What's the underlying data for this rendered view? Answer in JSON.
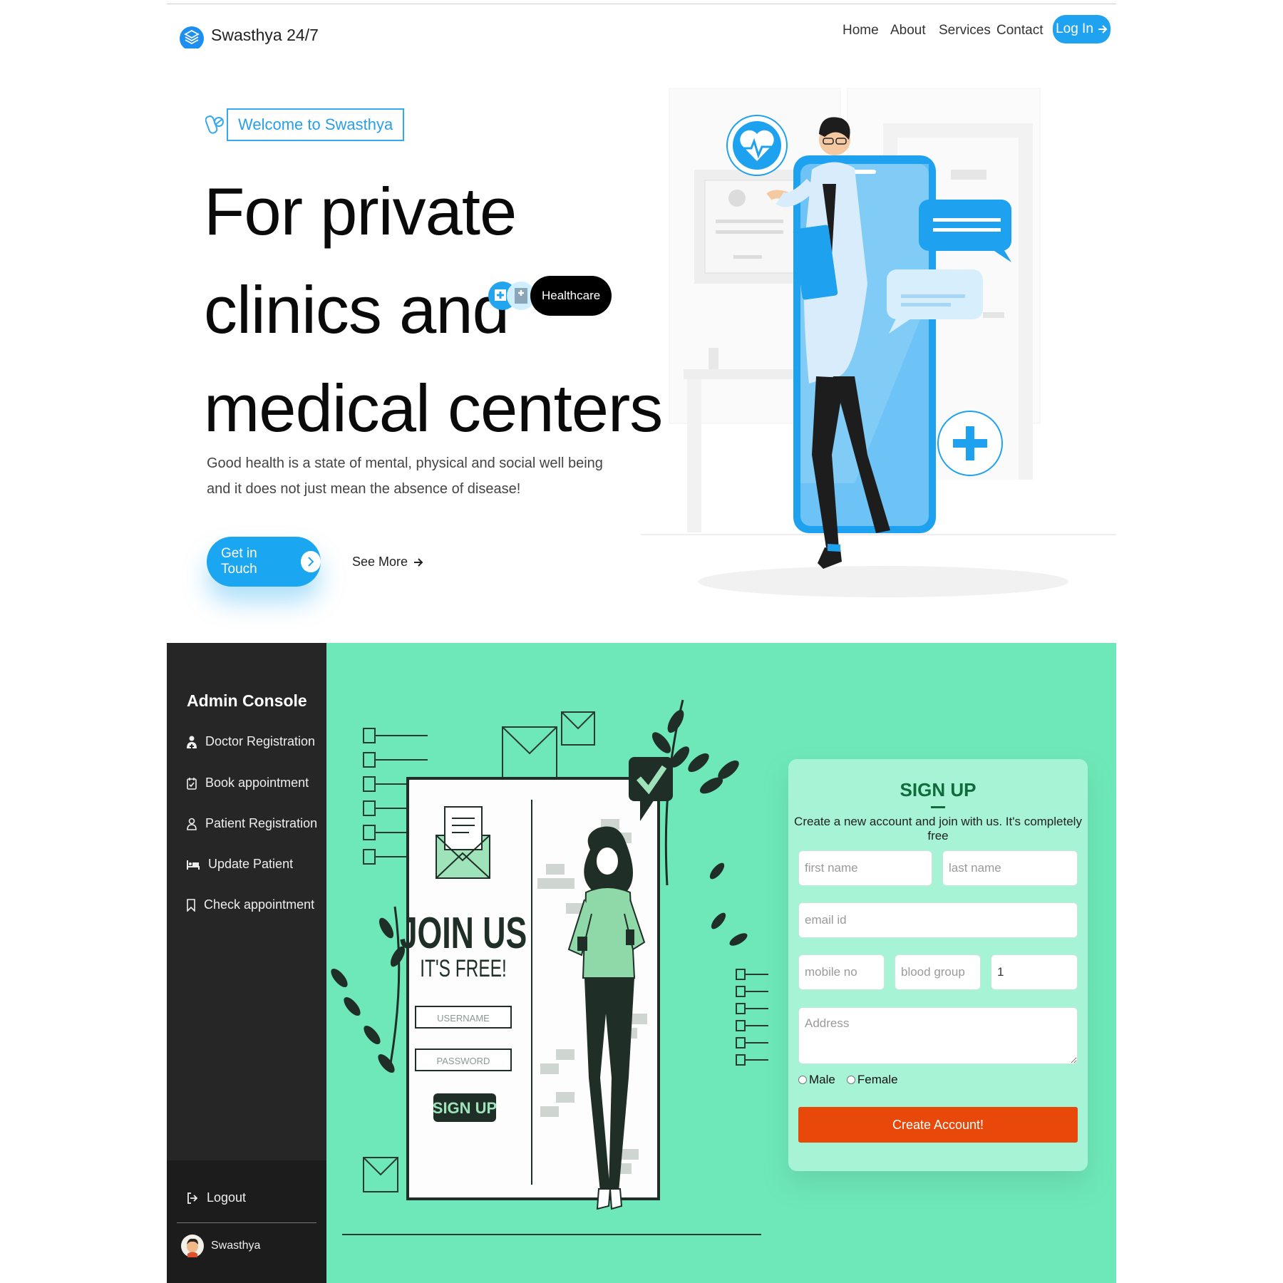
{
  "nav": {
    "brand": "Swasthya 24/7",
    "links": [
      "Home",
      "About",
      "Services",
      "Contact"
    ],
    "login_label": "Log In"
  },
  "hero": {
    "badge": "Welcome to Swasthya",
    "title_lines": [
      "For private",
      "clinics and",
      "medical centers"
    ],
    "tag": "Healthcare",
    "description": "Good health is a state of mental, physical and social well being and it does not just mean the absence of disease!",
    "cta_primary": "Get in Touch",
    "cta_secondary": "See More"
  },
  "sidebar": {
    "title": "Admin Console",
    "items": [
      {
        "label": "Doctor Registration",
        "icon": "doctor-icon"
      },
      {
        "label": "Book appointment",
        "icon": "calendar-check-icon"
      },
      {
        "label": "Patient Registration",
        "icon": "person-icon"
      },
      {
        "label": "Update Patient",
        "icon": "bed-icon"
      },
      {
        "label": "Check appointment",
        "icon": "bookmark-icon"
      }
    ],
    "logout_label": "Logout",
    "user_name": "Swasthya"
  },
  "illustration": {
    "join_title": "JOIN US",
    "join_sub": "IT'S FREE!",
    "username_label": "USERNAME",
    "password_label": "PASSWORD",
    "signup_label": "SIGN UP"
  },
  "signup": {
    "title": "SIGN UP",
    "subtitle": "Create a new account and join with us. It's completely free",
    "first_name_placeholder": "first name",
    "last_name_placeholder": "last name",
    "email_placeholder": "email id",
    "mobile_placeholder": "mobile no",
    "blood_placeholder": "blood group",
    "number_value": "1",
    "address_placeholder": "Address",
    "gender_male": "Male",
    "gender_female": "Female",
    "submit_label": "Create Account!"
  },
  "colors": {
    "brand_blue": "#1fa2f0",
    "mint": "#6ee8b8",
    "card_mint": "#a7f3d6",
    "sidebar_dark": "#262626",
    "cta_orange": "#e8490b",
    "signup_green": "#0f6b3a"
  }
}
